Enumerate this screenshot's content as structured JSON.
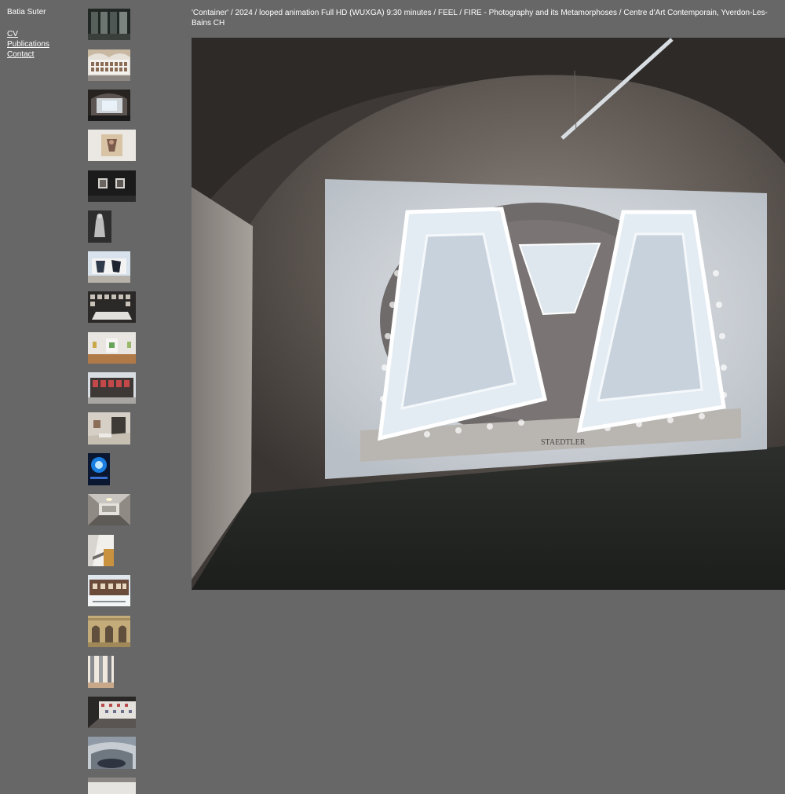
{
  "site": {
    "artist_name": "Batia Suter"
  },
  "nav": {
    "items": [
      {
        "label": "CV"
      },
      {
        "label": "Publications"
      },
      {
        "label": "Contact"
      }
    ]
  },
  "caption": "'Container' / 2024 / looped animation Full HD (WUXGA) 9:30 minutes / FEEL / FIRE - Photography and its Metamorphoses / Centre d'Art Contemporain, Yverdon-Les-Bains CH",
  "main_image": {
    "projection_text": "STAEDTLER"
  },
  "thumbnails": [
    {
      "name": "thumb-glass-gallery"
    },
    {
      "name": "thumb-vaulted-wall-grid"
    },
    {
      "name": "thumb-projection-vault"
    },
    {
      "name": "thumb-beige-object"
    },
    {
      "name": "thumb-dark-wall-frames"
    },
    {
      "name": "thumb-sculpture-bw"
    },
    {
      "name": "thumb-billboard"
    },
    {
      "name": "thumb-exhibition-table"
    },
    {
      "name": "thumb-white-gallery-green"
    },
    {
      "name": "thumb-building-facade"
    },
    {
      "name": "thumb-gallery-interior"
    },
    {
      "name": "thumb-blue-circle"
    },
    {
      "name": "thumb-room-installation"
    },
    {
      "name": "thumb-white-corner"
    },
    {
      "name": "thumb-historic-building"
    },
    {
      "name": "thumb-stone-arches"
    },
    {
      "name": "thumb-interior-columns"
    },
    {
      "name": "thumb-image-wall"
    },
    {
      "name": "thumb-amphitheater"
    },
    {
      "name": "thumb-white-box"
    }
  ]
}
